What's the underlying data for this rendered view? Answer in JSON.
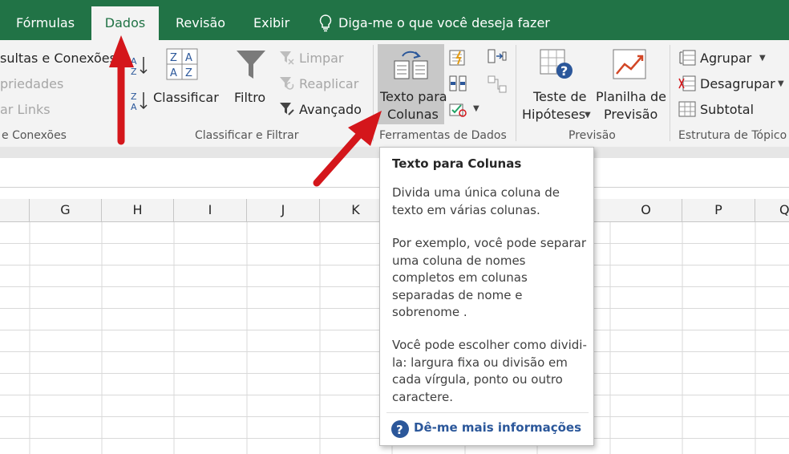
{
  "tabs": [
    {
      "label": "Fórmulas"
    },
    {
      "label": "Dados",
      "active": true
    },
    {
      "label": "Revisão"
    },
    {
      "label": "Exibir"
    }
  ],
  "tell_me": "Diga-me o que você deseja fazer",
  "ribbon": {
    "consultas": {
      "item1": "sultas e Conexões",
      "item2": "priedades",
      "item3": "ar Links",
      "group": "e Conexões"
    },
    "classificar_filtrar": {
      "classificar": "Classificar",
      "filtro": "Filtro",
      "limpar": "Limpar",
      "reaplicar": "Reaplicar",
      "avancado": "Avançado",
      "group": "Classificar e Filtrar"
    },
    "ferramentas": {
      "texto_line1": "Texto para",
      "texto_line2": "Colunas",
      "group": "Ferramentas de Dados"
    },
    "previsao": {
      "teste_line1": "Teste de",
      "teste_line2": "Hipóteses",
      "planilha_line1": "Planilha de",
      "planilha_line2": "Previsão",
      "group": "Previsão"
    },
    "estrutura": {
      "agrupar": "Agrupar",
      "desagrupar": "Desagrupar",
      "subtotal": "Subtotal",
      "group": "Estrutura de Tópico"
    }
  },
  "columns": [
    "G",
    "H",
    "I",
    "J",
    "K",
    "O",
    "P",
    "Q"
  ],
  "tooltip": {
    "title": "Texto para Colunas",
    "para1": "Divida uma única coluna de texto em várias colunas.",
    "para2": "Por exemplo, você pode separar uma coluna de nomes completos em colunas separadas de nome e sobrenome .",
    "para3": "Você pode escolher como dividi-la: largura fixa ou divisão em cada vírgula, ponto ou outro caractere.",
    "help": "Dê-me mais informações"
  },
  "colors": {
    "excel_green": "#217346",
    "ribbon_bg": "#f3f3f3",
    "annotation_red": "#d4161b",
    "help_blue": "#2b579a"
  }
}
